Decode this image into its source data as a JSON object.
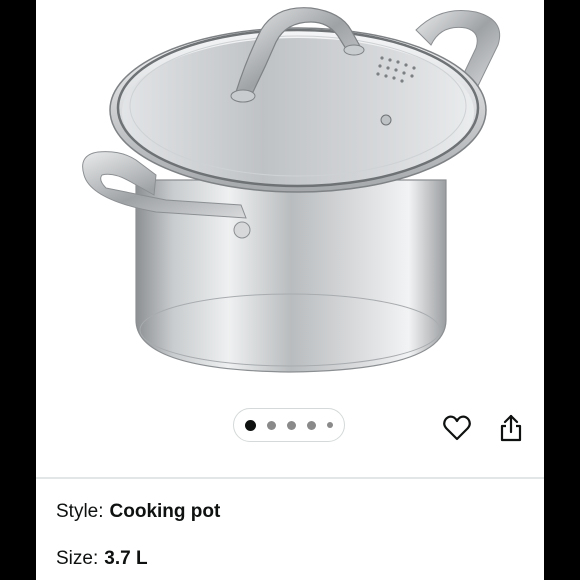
{
  "product": {
    "image_alt": "Stainless steel cooking pot with glass lid"
  },
  "carousel": {
    "total": 5,
    "active_index": 0
  },
  "actions": {
    "favorite_icon": "heart-outline-icon",
    "share_icon": "share-icon"
  },
  "specs": {
    "style_label": "Style:",
    "style_value": "Cooking pot",
    "size_label": "Size:",
    "size_value": "3.7 L"
  },
  "colors": {
    "frame": "#000000",
    "background": "#ffffff",
    "text": "#0f1111",
    "dot_inactive": "#8a8a8a"
  }
}
